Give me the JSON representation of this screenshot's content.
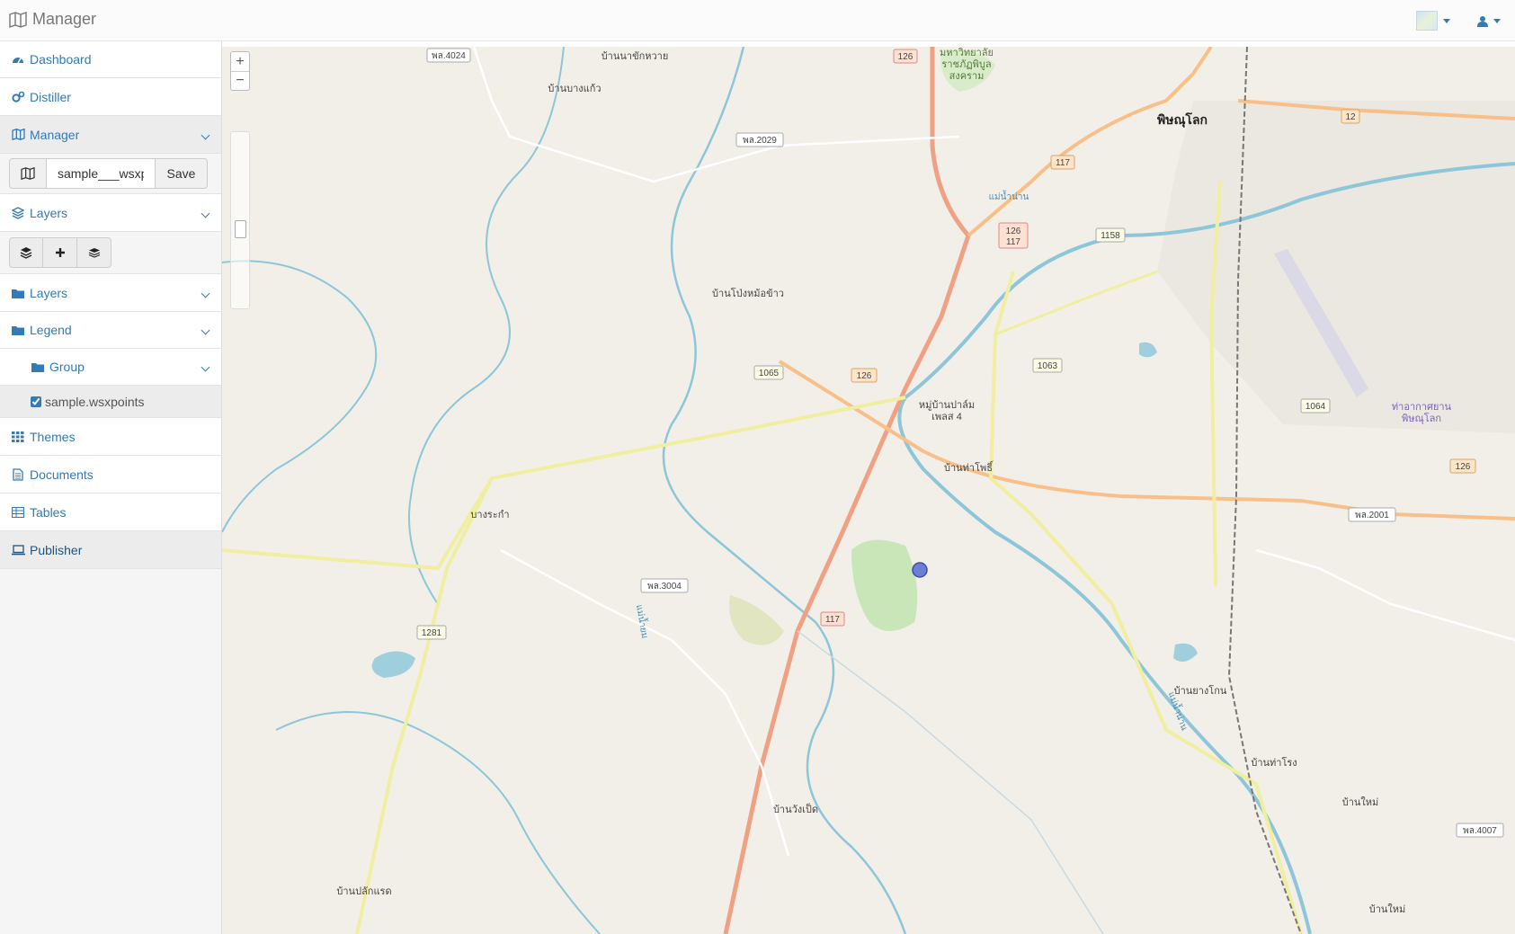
{
  "app": {
    "title": "Manager"
  },
  "navbar": {
    "basemap_icon": "basemap-thumbnail-icon",
    "user_icon": "user-icon"
  },
  "sidebar": {
    "items": [
      {
        "label": "Dashboard",
        "icon": "dashboard-icon"
      },
      {
        "label": "Distiller",
        "icon": "cogs-icon"
      },
      {
        "label": "Manager",
        "icon": "map-icon"
      },
      {
        "label": "Layers",
        "icon": "layers-icon"
      },
      {
        "label": "Layers",
        "icon": "folder-icon"
      },
      {
        "label": "Legend",
        "icon": "folder-icon"
      },
      {
        "label": "Group",
        "icon": "folder-icon"
      },
      {
        "label": "Themes",
        "icon": "grid-icon"
      },
      {
        "label": "Documents",
        "icon": "document-icon"
      },
      {
        "label": "Tables",
        "icon": "table-icon"
      },
      {
        "label": "Publisher",
        "icon": "laptop-icon"
      }
    ],
    "manager": {
      "map_name_value": "sample___wsxpoints",
      "save_label": "Save"
    },
    "legend_entry": {
      "label": "sample.wsxpoints",
      "checked": true
    }
  },
  "map": {
    "zoom_in": "+",
    "zoom_out": "−",
    "route_shields": [
      "wa.4024",
      "126",
      "12",
      "117",
      "wa.2029",
      "126 117",
      "1158",
      "1065",
      "126",
      "1063",
      "1064",
      "126",
      "wa.2001",
      "wa.3004",
      "117",
      "1281",
      "wa.4007"
    ],
    "shield_labels": {
      "s1": "พล.4024",
      "s2": "126",
      "s3": "12",
      "s4": "117",
      "s5": "พล.2029",
      "s6a": "126",
      "s6b": "117",
      "s7": "1158",
      "s8": "1065",
      "s9": "126",
      "s10": "1063",
      "s11": "1064",
      "s12": "126",
      "s13": "พล.2001",
      "s14": "พล.3004",
      "s15": "117",
      "s16": "1281",
      "s17": "พล.4007"
    },
    "place_labels": {
      "p1": "บ้านนาขักหวาย",
      "p2": "บ้านบางแก้ว",
      "p3": "มหาวิทยาลัย",
      "p3b": "ราชภัฏพิบูล",
      "p3c": "สงคราม",
      "p4": "พิษณุโลก",
      "p5": "บ้านโป่งหม้อข้าว",
      "p6": "หมู่บ้านปาล์ม",
      "p6b": "เพลส 4",
      "p7": "บ้านท่าโพธิ์",
      "p8": "บางระกำ",
      "p9": "ท่าอากาศยาน",
      "p9b": "พิษณุโลก",
      "p10": "บ้านยางโกน",
      "p11": "บ้านท่าโรง",
      "p12": "บ้านใหม่",
      "p13": "บ้านวังเป็ด",
      "p14": "บ้านใหม่",
      "p15": "บ้านปลักแรด",
      "r1": "แม่น้ำน่าน",
      "r2": "แม่น้ำน่าน",
      "r3": "แม่น้ำยม"
    },
    "colors": {
      "land": "#f2efe9",
      "water": "#9fcfdd",
      "river": "#8cc6d8",
      "primary": "#f0a183",
      "secondary": "#f8d8a6",
      "tertiary": "#f3f1b0",
      "park": "#c8e6b8",
      "point": "#6b7fd6"
    }
  }
}
